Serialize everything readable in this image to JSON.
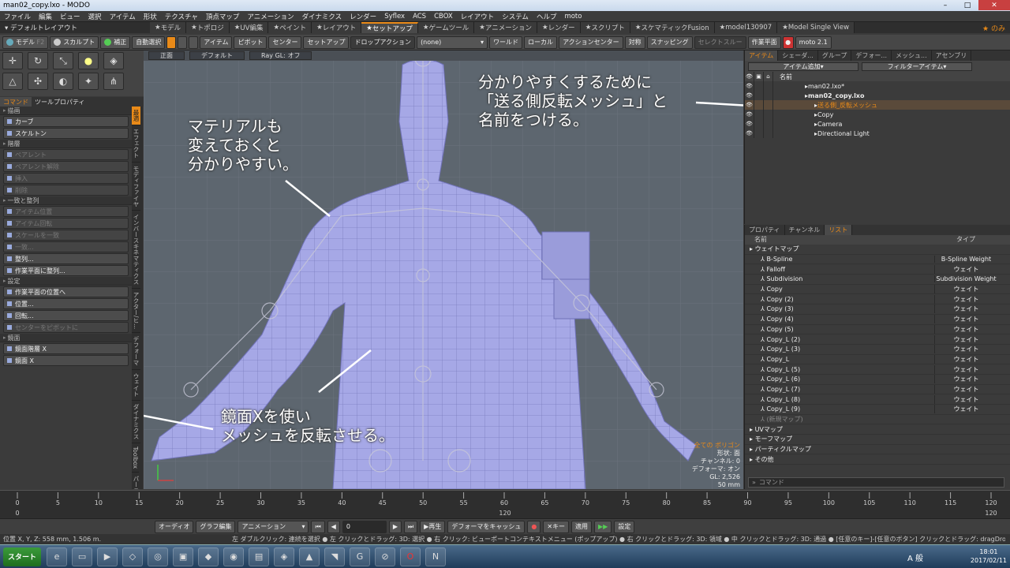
{
  "window": {
    "title": "man02_copy.lxo - MODO",
    "controls": [
      "–",
      "□",
      "✕"
    ]
  },
  "menu": [
    "ファイル",
    "編集",
    "ビュー",
    "選択",
    "アイテム",
    "形状",
    "テクスチャ",
    "頂点マップ",
    "アニメーション",
    "ダイナミクス",
    "レンダー",
    "Syflex",
    "ACS",
    "CBOX",
    "レイアウト",
    "システム",
    "ヘルプ",
    "moto"
  ],
  "layout": {
    "current": "デフォルトレイアウト",
    "tabs": [
      "モデル",
      "トポロジ",
      "UV編集",
      "ペイント",
      "レイアウト",
      "セットアップ",
      "ゲームツール",
      "アニメーション",
      "レンダー",
      "スクリプト",
      "スケマティックFusion",
      "model130907",
      "Model Single View"
    ],
    "active_tab": "セットアップ",
    "right_label": "のみ"
  },
  "toolbar": {
    "model": "モデル",
    "model_key": "F2",
    "sculpt": "スカルプト",
    "refine": "補正",
    "autoselect": "自動選択",
    "item": "アイテム",
    "pivot": "ピボット",
    "center": "センター",
    "setup": "セットアップ",
    "dropaction": "ドロップアクション",
    "none": "(none)",
    "world": "ワールド",
    "local": "ローカル",
    "action_center": "アクションセンター",
    "symmetry": "対称",
    "snapping": "スナッピング",
    "select_through": "セレクトスルー",
    "workplane": "作業平面",
    "moto": "moto 2.1"
  },
  "left": {
    "tabs": [
      "コマンド",
      "ツールプロパティ"
    ],
    "sections": [
      {
        "title": "描画",
        "buttons": [
          {
            "label": "カーブ",
            "enabled": true
          },
          {
            "label": "スケルトン",
            "enabled": true
          }
        ]
      },
      {
        "title": "階層",
        "buttons": [
          {
            "label": "ペアレント",
            "enabled": false
          },
          {
            "label": "ペアレント解除",
            "enabled": false
          },
          {
            "label": "挿入",
            "enabled": false
          },
          {
            "label": "削除",
            "enabled": false
          }
        ]
      },
      {
        "title": "一致と整列",
        "buttons": [
          {
            "label": "アイテム位置",
            "enabled": false
          },
          {
            "label": "アイテム回転",
            "enabled": false
          },
          {
            "label": "スケールを一致",
            "enabled": false
          },
          {
            "label": "一致...",
            "enabled": false
          },
          {
            "label": "整列...",
            "enabled": true
          },
          {
            "label": "作業平面に整列...",
            "enabled": true
          }
        ]
      },
      {
        "title": "設定",
        "buttons": [
          {
            "label": "作業平面の位置へ",
            "enabled": true
          }
        ]
      },
      {
        "title": "",
        "buttons": [
          {
            "label": "位置...",
            "enabled": true
          },
          {
            "label": "回転...",
            "enabled": true
          },
          {
            "label": "センターをピボットに",
            "enabled": false
          }
        ]
      },
      {
        "title": "鏡面",
        "buttons": [
          {
            "label": "鏡面階層 X",
            "enabled": true
          },
          {
            "label": "鏡面 X",
            "enabled": true
          }
        ]
      }
    ],
    "vtabs": [
      "最適",
      "エフェクト",
      "モディファイヤ",
      "インバースキネマティクス",
      "アクター/ヒ...",
      "デフォーマ",
      "ウェイト",
      "ダイナミクス",
      "Toolbox",
      "パーティクル",
      "ACS",
      "BVH"
    ]
  },
  "viewport": {
    "tabs": [
      "正面",
      "デフォルト",
      "Ray GL: オフ"
    ],
    "info": {
      "line1": "全ての ポリゴン",
      "line2": "形状: 面",
      "line3": "チャンネル: 0",
      "line4": "デフォーマ: オン",
      "line5": "GL: 2,526",
      "line6": "50 mm"
    },
    "callouts": {
      "material": "マテリアルも\n変えておくと\n分かりやすい。",
      "rename": "分かりやすくするために\n「送る側反転メッシュ」と\n名前をつける。",
      "mirror": "鏡面Xを使い\nメッシュを反転させる。"
    }
  },
  "items_panel": {
    "tabs": [
      "アイテム",
      "シェーダ...",
      "グループ",
      "デフォー...",
      "メッシュ...",
      "アセンブリ"
    ],
    "add_item": "アイテム追加",
    "filter": "フィルターアイテム",
    "name_header": "名前",
    "rows": [
      {
        "label": "man02.lxo*",
        "indent": 0,
        "bold": false,
        "selected": false
      },
      {
        "label": "man02_copy.lxo",
        "indent": 0,
        "bold": true,
        "selected": false
      },
      {
        "label": "送る側_反転メッシュ",
        "indent": 1,
        "bold": false,
        "selected": true
      },
      {
        "label": "Copy",
        "indent": 1,
        "bold": false,
        "selected": false
      },
      {
        "label": "Camera",
        "indent": 1,
        "bold": false,
        "selected": false
      },
      {
        "label": "Directional Light",
        "indent": 1,
        "bold": false,
        "selected": false
      }
    ]
  },
  "list_panel": {
    "tabs": [
      "プロパティ",
      "チャンネル",
      "リスト"
    ],
    "headers": [
      "名前",
      "タイプ"
    ],
    "rows": [
      {
        "name": "ウェイトマップ",
        "type": "",
        "level": 0
      },
      {
        "name": "B-Spline",
        "type": "B-Spline Weight",
        "level": 1
      },
      {
        "name": "Falloff",
        "type": "ウェイト",
        "level": 1
      },
      {
        "name": "Subdivision",
        "type": "Subdivision Weight",
        "level": 1
      },
      {
        "name": "Copy",
        "type": "ウェイト",
        "level": 1
      },
      {
        "name": "Copy (2)",
        "type": "ウェイト",
        "level": 1
      },
      {
        "name": "Copy (3)",
        "type": "ウェイト",
        "level": 1
      },
      {
        "name": "Copy (4)",
        "type": "ウェイト",
        "level": 1
      },
      {
        "name": "Copy (5)",
        "type": "ウェイト",
        "level": 1
      },
      {
        "name": "Copy_L (2)",
        "type": "ウェイト",
        "level": 1
      },
      {
        "name": "Copy_L (3)",
        "type": "ウェイト",
        "level": 1
      },
      {
        "name": "Copy_L",
        "type": "ウェイト",
        "level": 1
      },
      {
        "name": "Copy_L (5)",
        "type": "ウェイト",
        "level": 1
      },
      {
        "name": "Copy_L (6)",
        "type": "ウェイト",
        "level": 1
      },
      {
        "name": "Copy_L (7)",
        "type": "ウェイト",
        "level": 1
      },
      {
        "name": "Copy_L (8)",
        "type": "ウェイト",
        "level": 1
      },
      {
        "name": "Copy_L (9)",
        "type": "ウェイト",
        "level": 1
      },
      {
        "name": "(新規マップ)",
        "type": "",
        "level": 1
      },
      {
        "name": "UVマップ",
        "type": "",
        "level": 0
      },
      {
        "name": "モーフマップ",
        "type": "",
        "level": 0
      },
      {
        "name": "パーティクルマップ",
        "type": "",
        "level": 0
      },
      {
        "name": "その他",
        "type": "",
        "level": 0
      }
    ],
    "command_placeholder": "コマンド"
  },
  "timeline": {
    "ticks": [
      "0",
      "5",
      "10",
      "15",
      "20",
      "25",
      "30",
      "35",
      "40",
      "45",
      "50",
      "55",
      "60",
      "65",
      "70",
      "75",
      "80",
      "85",
      "90",
      "95",
      "100",
      "105",
      "110",
      "115",
      "120"
    ],
    "end_label": "120",
    "frame": "0",
    "audio": "オーディオ",
    "graph": "グラフ編集",
    "animation": "アニメーション",
    "play": "再生",
    "cache": "デフォーマをキャッシュ",
    "key": "キー",
    "apply": "適用",
    "settings": "設定"
  },
  "status": {
    "coords": "位置 X, Y, Z:  558 mm, 1.506 m.",
    "hint": "左 ダブルクリック: 連続を選択 ● 左 クリックとドラッグ: 3D: 選択 ● 右 クリック: ビューポートコンテキストメニュー (ポップアップ) ● 右 クリックとドラッグ: 3D: 領域 ● 中 クリックとドラッグ: 3D: 通過 ● [任意のキー]-[任意のボタン] クリックとドラッグ: dragDropBegin"
  },
  "taskbar": {
    "start": "スタート",
    "time": "18:01",
    "date": "2017/02/11",
    "ime": "A 般"
  }
}
